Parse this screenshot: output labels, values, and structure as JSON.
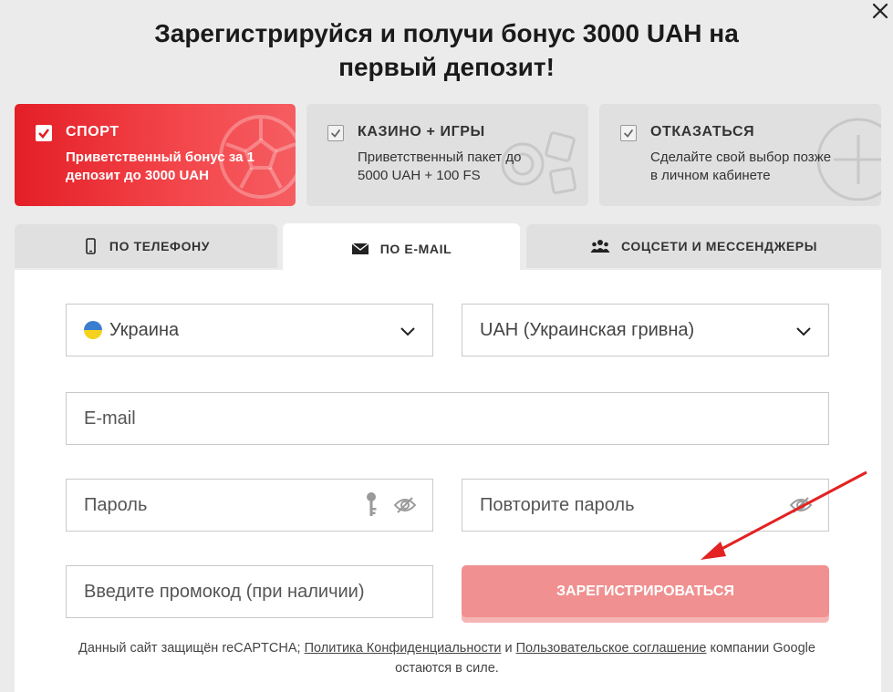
{
  "title_line1": "Зарегистрируйся и получи бонус 3000 UAH на",
  "title_line2": "первый депозит!",
  "bonus_cards": [
    {
      "title": "СПОРТ",
      "desc_line1": "Приветственный бонус за 1",
      "desc_line2": "депозит до 3000 UAH",
      "selected": true
    },
    {
      "title": "КАЗИНО + ИГРЫ",
      "desc_line1": "Приветственный пакет до",
      "desc_line2": "5000 UAH + 100 FS",
      "selected": false
    },
    {
      "title": "ОТКАЗАТЬСЯ",
      "desc_line1": "Сделайте свой выбор позже",
      "desc_line2": "в личном кабинете",
      "selected": false
    }
  ],
  "tabs": {
    "phone": "ПО ТЕЛЕФОНУ",
    "email": "ПО E-MAIL",
    "social": "СОЦСЕТИ И МЕССЕНДЖЕРЫ"
  },
  "form": {
    "country": "Украина",
    "currency": "UAH (Украинская гривна)",
    "email_placeholder": "E-mail",
    "password_placeholder": "Пароль",
    "repeat_password_placeholder": "Повторите пароль",
    "promo_placeholder": "Введите промокод (при наличии)",
    "register_label": "ЗАРЕГИСТРИРОВАТЬСЯ"
  },
  "legal": {
    "text_start": "Данный сайт защищён reCAPTCHA;",
    "privacy_link": "Политика Конфиденциальности",
    "and": "и",
    "terms_link": "Пользовательское соглашение",
    "text_end": "компании Google",
    "line2": "остаются в силе."
  },
  "colors": {
    "accent": "#e41e26",
    "register_button": "#f09090",
    "annotation_arrow": "#e32222"
  },
  "icons": {
    "close": "close-icon",
    "check": "check-icon",
    "phone": "phone-icon",
    "email": "envelope-icon",
    "social": "people-icon",
    "chevron": "chevron-down-icon",
    "key": "key-icon",
    "eye": "eye-slash-icon"
  }
}
